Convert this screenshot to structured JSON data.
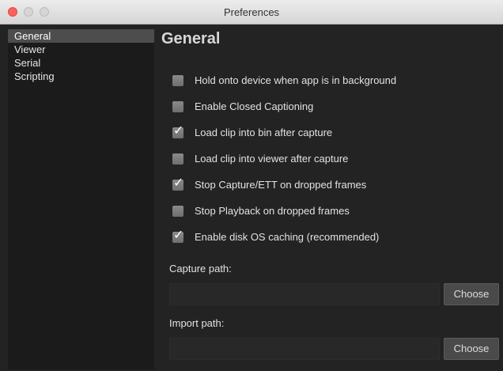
{
  "window": {
    "title": "Preferences"
  },
  "sidebar": {
    "items": [
      {
        "label": "General",
        "selected": true
      },
      {
        "label": "Viewer",
        "selected": false
      },
      {
        "label": "Serial",
        "selected": false
      },
      {
        "label": "Scripting",
        "selected": false
      }
    ]
  },
  "main": {
    "heading": "General",
    "options": [
      {
        "label": "Hold onto device when app is in background",
        "checked": false
      },
      {
        "label": "Enable Closed Captioning",
        "checked": false
      },
      {
        "label": "Load clip into bin after capture",
        "checked": true
      },
      {
        "label": "Load clip into viewer after capture",
        "checked": false
      },
      {
        "label": "Stop Capture/ETT on dropped frames",
        "checked": true
      },
      {
        "label": "Stop Playback on dropped frames",
        "checked": false
      },
      {
        "label": "Enable disk OS caching (recommended)",
        "checked": true
      }
    ],
    "capture_path": {
      "label": "Capture path:",
      "value": "",
      "button": "Choose"
    },
    "import_path": {
      "label": "Import path:",
      "value": "",
      "button": "Choose"
    }
  },
  "icons": {
    "checkmark": "checkmark-icon"
  },
  "colors": {
    "window_bg": "#232323",
    "sidebar_bg": "#1b1b1b",
    "selected_bg": "#4d4d4d",
    "close_button": "#fc605c"
  }
}
